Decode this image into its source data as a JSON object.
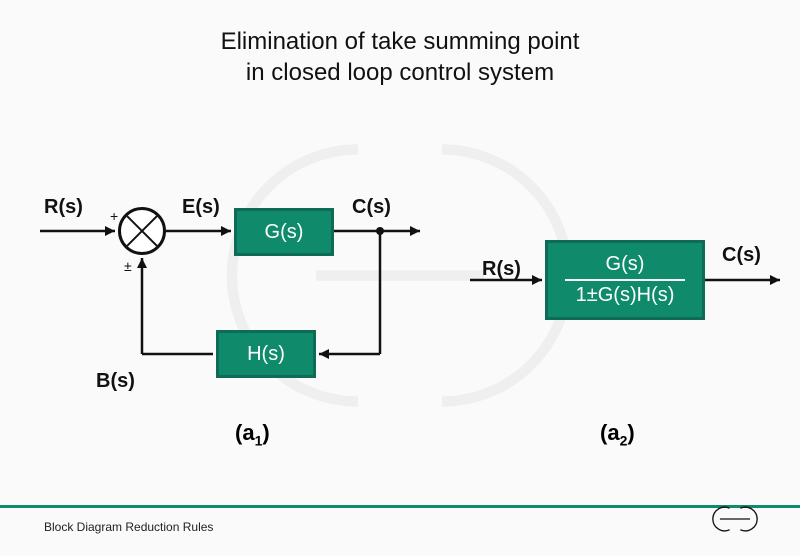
{
  "title_line1": "Elimination of take summing point",
  "title_line2": "in closed loop control system",
  "signals": {
    "R": "R(s)",
    "E": "E(s)",
    "C": "C(s)",
    "B": "B(s)",
    "R2": "R(s)",
    "C2": "C(s)"
  },
  "blocks": {
    "G": "G(s)",
    "H": "H(s)",
    "closed_num": "G(s)",
    "closed_den": "1±G(s)H(s)"
  },
  "signs": {
    "plus": "+",
    "pm": "±"
  },
  "captions": {
    "a1_prefix": "(a",
    "a1_sub": "1",
    "a1_suffix": ")",
    "a2_prefix": "(a",
    "a2_sub": "2",
    "a2_suffix": ")"
  },
  "footer": "Block Diagram Reduction Rules"
}
